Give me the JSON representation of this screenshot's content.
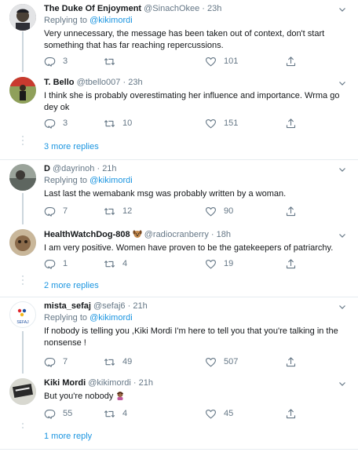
{
  "tweets": [
    {
      "name": "The Duke Of Enjoyment",
      "handle": "@SinachOkee",
      "time": "23h",
      "reply_prefix": "Replying to",
      "reply_to": "@kikimordi",
      "text": "Very unnecessary, the message has been taken out of context, don't start something that has far reaching repercussions.",
      "replies": "3",
      "retweets": "",
      "likes": "101"
    },
    {
      "name": "T. Bello",
      "handle": "@tbello007",
      "time": "23h",
      "text": "I think she is probably overestimating her influence and importance. Wrma go dey ok",
      "replies": "3",
      "retweets": "10",
      "likes": "151"
    },
    {
      "name": "D",
      "handle": "@dayrinoh",
      "time": "21h",
      "reply_prefix": "Replying to",
      "reply_to": "@kikimordi",
      "text": "Last last the wemabank msg was probably written by a woman.",
      "replies": "7",
      "retweets": "12",
      "likes": "90"
    },
    {
      "name": "HealthWatchDog-808",
      "handle": "@radiocranberry",
      "time": "18h",
      "text": "I am very positive. Women have proven to be the gatekeepers of patriarchy.",
      "replies": "1",
      "retweets": "4",
      "likes": "19"
    },
    {
      "name": "mista_sefaj",
      "handle": "@sefaj6",
      "time": "21h",
      "reply_prefix": "Replying to",
      "reply_to": "@kikimordi",
      "text": "If nobody is telling you ,Kiki Mordi I'm here to tell you that you're talking in the nonsense !",
      "replies": "7",
      "retweets": "49",
      "likes": "507",
      "avatar_label": "SEFAJ"
    },
    {
      "name": "Kiki Mordi",
      "handle": "@kikimordi",
      "time": "21h",
      "text": "But you're nobody",
      "replies": "55",
      "retweets": "4",
      "likes": "45"
    }
  ],
  "more_replies": [
    "3 more replies",
    "2 more replies",
    "1 more reply"
  ],
  "separator": "·",
  "colors": {
    "link": "#1b95e0",
    "muted": "#657786",
    "text": "#14171a",
    "divider": "#e6ecf0",
    "thread_line": "#ccd6dd"
  },
  "icons": [
    "reply-icon",
    "retweet-icon",
    "like-icon",
    "share-icon",
    "caret-down-icon",
    "dog-emoji-icon",
    "facepalm-emoji-icon"
  ]
}
